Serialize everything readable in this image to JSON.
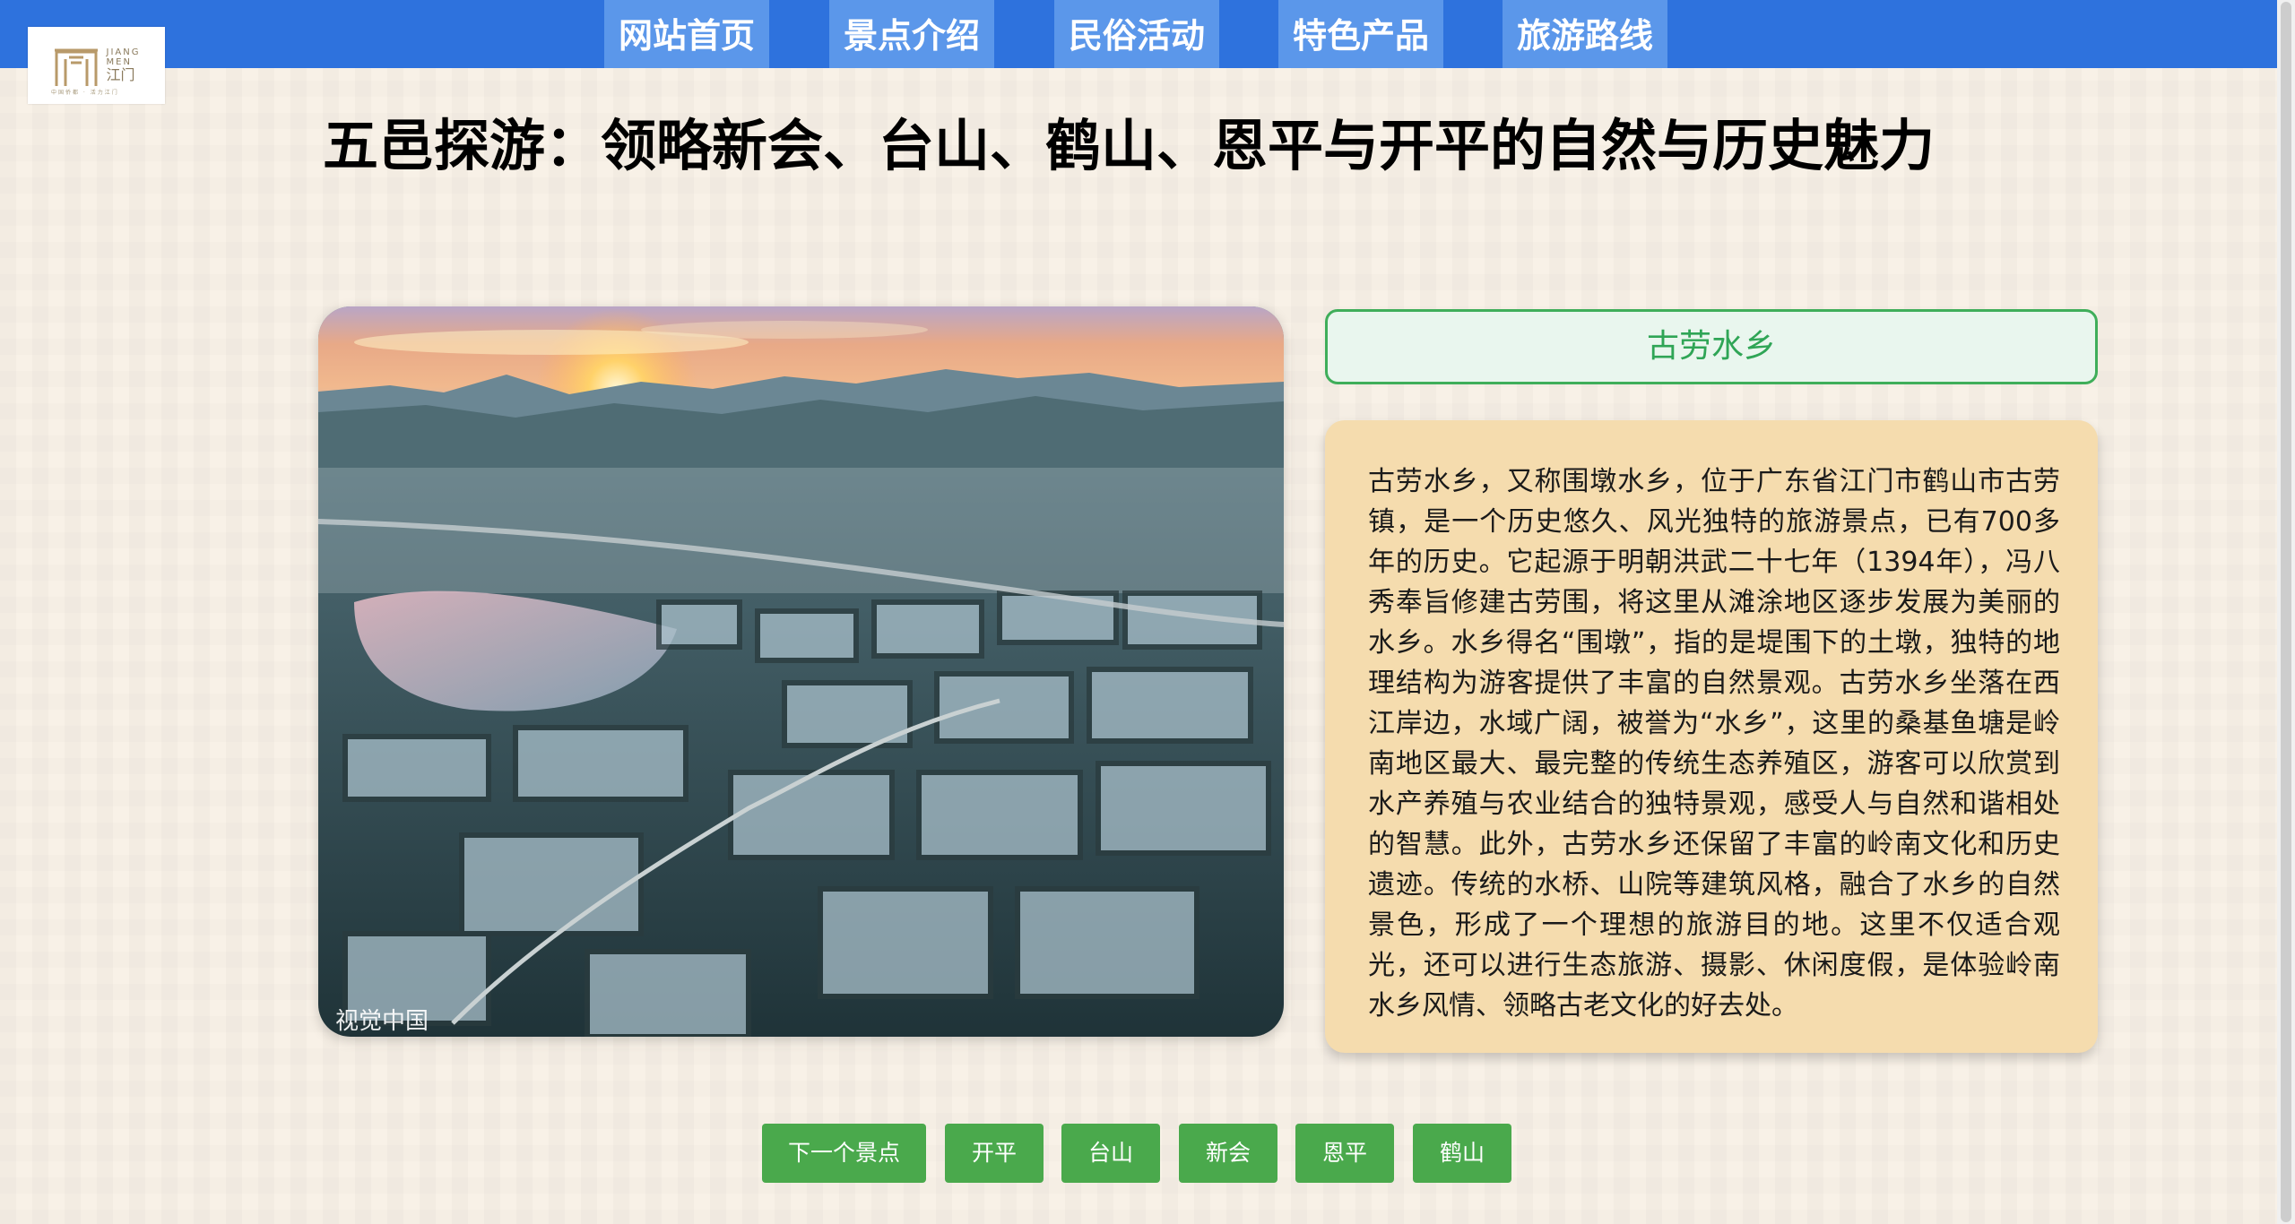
{
  "nav": {
    "items": [
      "网站首页",
      "景点介绍",
      "民俗活动",
      "特色产品",
      "旅游路线"
    ]
  },
  "logo": {
    "en_line1": "JIANG",
    "en_line2": "MEN",
    "cn": "江门",
    "tagline": "中国侨都 · 活力江门"
  },
  "page_title": "五邑探游：领略新会、台山、鹤山、恩平与开平的自然与历史魅力",
  "photo": {
    "credit": "视觉中国",
    "subject": "aerial-sunset-fish-ponds"
  },
  "spot": {
    "name": "古劳水乡",
    "description": "古劳水乡，又称围墩水乡，位于广东省江门市鹤山市古劳镇，是一个历史悠久、风光独特的旅游景点，已有700多年的历史。它起源于明朝洪武二十七年（1394年），冯八秀奉旨修建古劳围，将这里从滩涂地区逐步发展为美丽的水乡。水乡得名“围墩”，指的是堤围下的土墩，独特的地理结构为游客提供了丰富的自然景观。古劳水乡坐落在西江岸边，水域广阔，被誉为“水乡”，这里的桑基鱼塘是岭南地区最大、最完整的传统生态养殖区，游客可以欣赏到水产养殖与农业结合的独特景观，感受人与自然和谐相处的智慧。此外，古劳水乡还保留了丰富的岭南文化和历史遗迹。传统的水桥、山院等建筑风格，融合了水乡的自然景色，形成了一个理想的旅游目的地。这里不仅适合观光，还可以进行生态旅游、摄影、休闲度假，是体验岭南水乡风情、领略古老文化的好去处。"
  },
  "buttons": {
    "next": "下一个景点",
    "kaiping": "开平",
    "taishan": "台山",
    "xinhui": "新会",
    "enping": "恩平",
    "heshan": "鹤山"
  },
  "colors": {
    "nav_bar": "#2e72dd",
    "nav_item": "#5b97ea",
    "title_border": "#3fae5a",
    "card_bg": "#f5dcae",
    "button": "#4aa94c",
    "page_bg": "#f8f1e7"
  }
}
